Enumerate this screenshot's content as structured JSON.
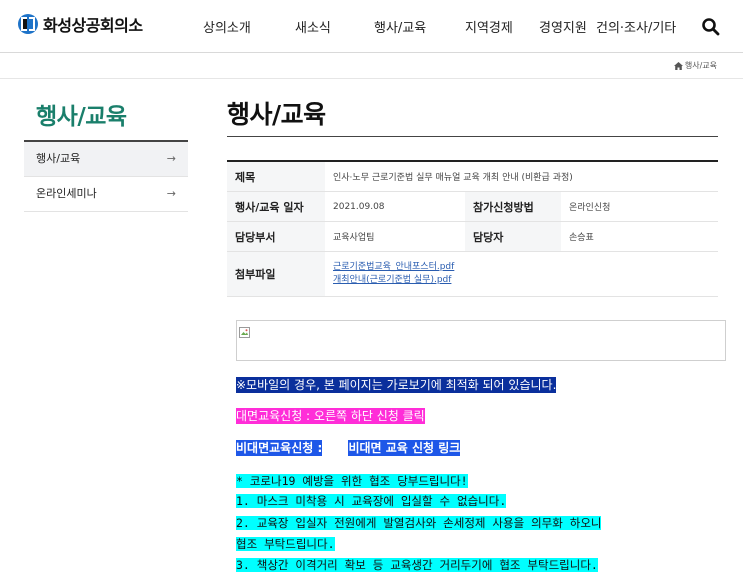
{
  "header": {
    "logo_text": "화성상공회의소",
    "nav": [
      "상의소개",
      "새소식",
      "행사/교육",
      "지역경제",
      "경영지원",
      "건의·조사/기타"
    ]
  },
  "breadcrumb": {
    "home_icon": "home-icon",
    "label": "행사/교육"
  },
  "sidebar": {
    "title": "행사/교육",
    "items": [
      {
        "label": "행사/교육",
        "arrow": "→"
      },
      {
        "label": "온라인세미나",
        "arrow": "→"
      }
    ]
  },
  "main": {
    "title": "행사/교육",
    "table": {
      "subject_label": "제목",
      "subject": "인사·노무 근로기준법 실무 매뉴얼 교육 개최 안내 (비환급 과정)",
      "date_label": "행사/교육 일자",
      "date": "2021.09.08",
      "apply_label": "참가신청방법",
      "apply": "온라인신청",
      "dept_label": "담당부서",
      "dept": "교육사업팀",
      "manager_label": "담당자",
      "manager": "손승표",
      "files_label": "첨부파일",
      "files": [
        "근로기준법교육_안내포스터.pdf",
        "개최안내(근로기준법 실무).pdf"
      ]
    },
    "notices": {
      "mobile": "※모바일의 경우, 본 페이지는 가로보기에 최적화 되어 있습니다.",
      "offline": "대면교육신청 : 오른쪽 하단 신청 클릭",
      "online_label": "비대면교육신청 :",
      "online_link": "비대면 교육 신청 링크",
      "covid": [
        "* 코로나19 예방을 위한 협조 당부드립니다!",
        "1. 마스크 미착용 시 교육장에 입실할 수 없습니다.",
        "2. 교육장 입실자 전원에게 발열검사와 손세정제 사용을 의무화 하오니",
        "협조 부탁드립니다.",
        "3. 책상간 이격거리 확보 등 교육생간 거리두기에 협조 부탁드립니다."
      ]
    }
  },
  "colors": {
    "accent": "#1a7f6b",
    "logo_blue": "#1e73c8",
    "hl_navy": "#0a2f9c",
    "hl_magenta": "#ff2dd8",
    "hl_blue": "#1e57e8",
    "hl_cyan": "#00ffff"
  }
}
